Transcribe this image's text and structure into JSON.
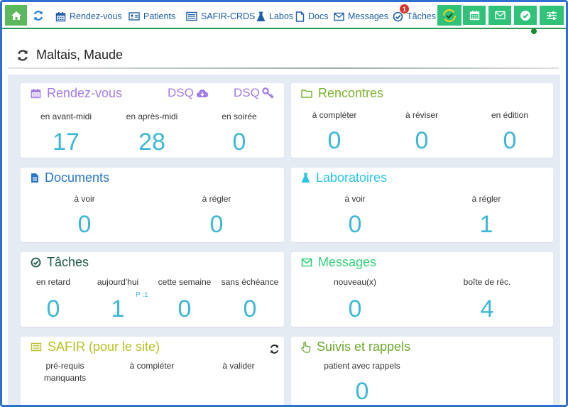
{
  "nav": {
    "items": [
      {
        "label": "Rendez-vous"
      },
      {
        "label": "Patients"
      },
      {
        "label": "SAFIR-CRDS"
      },
      {
        "label": "Labos"
      },
      {
        "label": "Docs"
      },
      {
        "label": "Messages"
      },
      {
        "label": "Tâches"
      }
    ],
    "taches_badge": "1"
  },
  "patient": {
    "name": "Maltais, Maude"
  },
  "cards": {
    "rdv": {
      "title": "Rendez-vous",
      "dsq1": "DSQ",
      "dsq2": "DSQ",
      "stats": [
        {
          "label": "en avant-midi",
          "value": "17"
        },
        {
          "label": "en après-midi",
          "value": "28"
        },
        {
          "label": "en soirée",
          "value": "0"
        }
      ]
    },
    "rencontres": {
      "title": "Rencontres",
      "stats": [
        {
          "label": "à compléter",
          "value": "0"
        },
        {
          "label": "à réviser",
          "value": "0"
        },
        {
          "label": "en édition",
          "value": "0"
        }
      ]
    },
    "documents": {
      "title": "Documents",
      "stats": [
        {
          "label": "à voir",
          "value": "0"
        },
        {
          "label": "à régler",
          "value": "0"
        }
      ]
    },
    "labos": {
      "title": "Laboratoires",
      "stats": [
        {
          "label": "à voir",
          "value": "0"
        },
        {
          "label": "à régler",
          "value": "1"
        }
      ]
    },
    "taches": {
      "title": "Tâches",
      "sub": "P :1",
      "stats": [
        {
          "label": "en retard",
          "value": "0"
        },
        {
          "label": "aujourd'hui",
          "value": "1"
        },
        {
          "label": "cette semaine",
          "value": "0"
        },
        {
          "label": "sans échéance",
          "value": "0"
        }
      ]
    },
    "messages": {
      "title": "Messages",
      "stats": [
        {
          "label": "nouveau(x)",
          "value": "0"
        },
        {
          "label": "boîte de réc.",
          "value": "4"
        }
      ]
    },
    "safir": {
      "title": "SAFIR (pour le site)",
      "stats": [
        {
          "label": "pré-requis manquants"
        },
        {
          "label": "à compléter"
        },
        {
          "label": "à valider"
        }
      ]
    },
    "suivis": {
      "title": "Suivis et rappels",
      "stats": [
        {
          "label": "patient avec rappels",
          "value": "0"
        }
      ]
    }
  },
  "colors": {
    "nav_link": "#1f5fa8",
    "green_btn": "#2fc278",
    "home_btn": "#5cb85c",
    "value": "#3db8d6",
    "rdv": "#a27ae6",
    "rencontres": "#7ab32e",
    "documents": "#2677c9",
    "labos": "#27c4e3",
    "taches": "#1d5a4a",
    "messages": "#33d07a",
    "safir": "#b8c020",
    "suivis": "#6aa82a"
  }
}
